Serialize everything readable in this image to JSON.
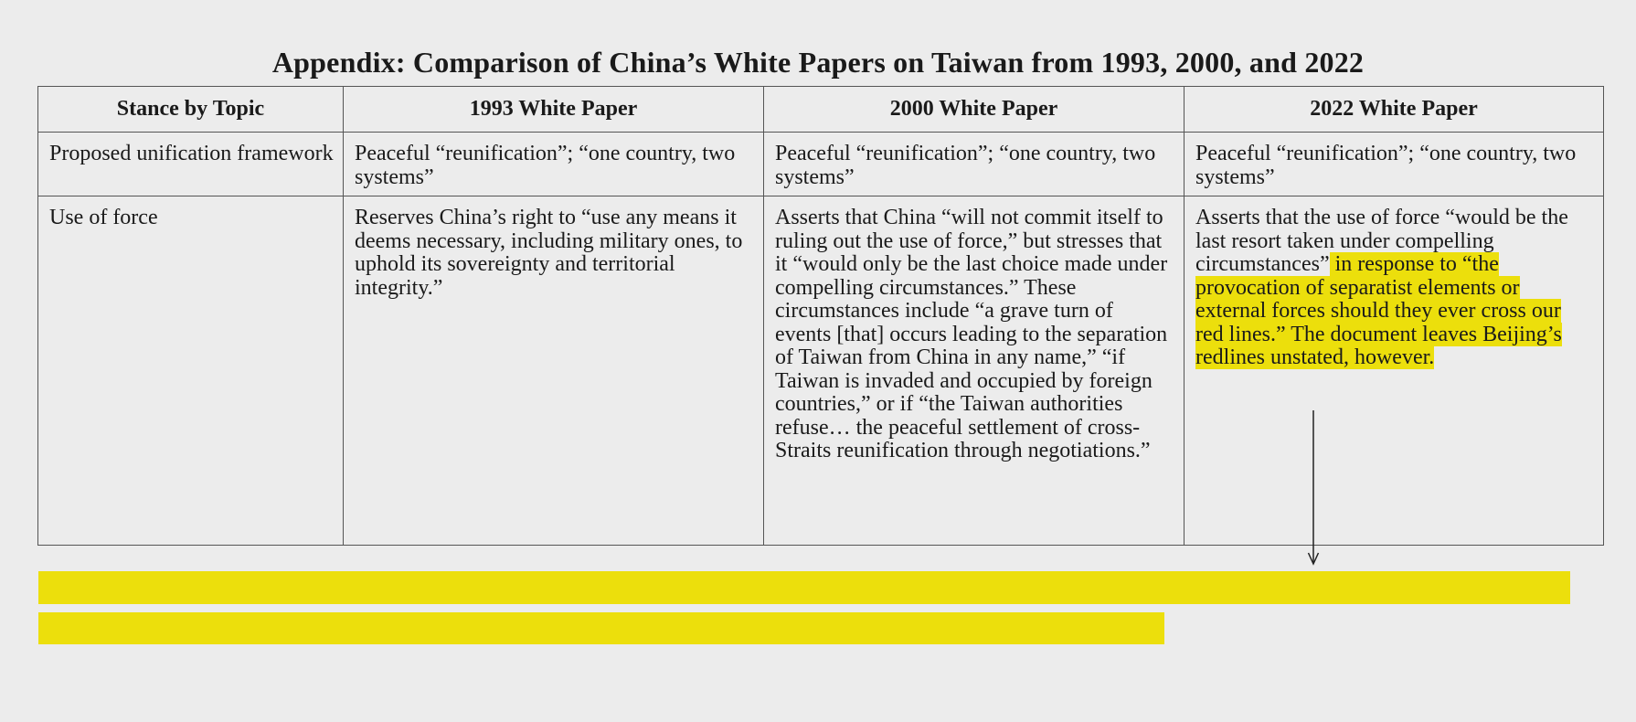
{
  "title": "Appendix: Comparison of China’s White Papers on Taiwan from 1993, 2000, and 2022",
  "table": {
    "headers": [
      "Stance by Topic",
      "1993 White Paper",
      "2000 White Paper",
      "2022 White Paper"
    ],
    "rows": [
      {
        "topic": "Proposed unification framework",
        "y1993": "Peaceful “reunification”; “one country, two systems”",
        "y2000": "Peaceful “reunification”; “one country, two systems”",
        "y2022": "Peaceful “reunification”; “one country, two systems”"
      },
      {
        "topic": "Use of force",
        "y1993": "Reserves China’s right to “use any means it deems necessary, including military ones, to uphold its sovereignty and territorial integrity.”",
        "y2000": "Asserts that China “will not commit itself to ruling out the use of force,” but stresses that it “would only be the last choice made under compelling circumstances.” These circumstances include “a grave turn of events [that] occurs leading to the separation of Taiwan from China in any name,” “if Taiwan is invaded and occupied by foreign countries,” or if “the Taiwan authorities refuse… the peaceful settlement of cross-Straits reunification through negotiations.”",
        "y2022_plain": "Asserts that the use of force “would be the last resort taken under compelling circumstances”",
        "y2022_highlight": " in response to “the provocation of separatist elements or external forces should they ever cross our red lines.” The document leaves Beijing’s redlines unstated, however."
      }
    ]
  },
  "colors": {
    "highlight": "#ecdf0c",
    "background": "#ececec",
    "border": "#555555"
  },
  "icons": {
    "annotation_arrow": "down-arrow"
  }
}
